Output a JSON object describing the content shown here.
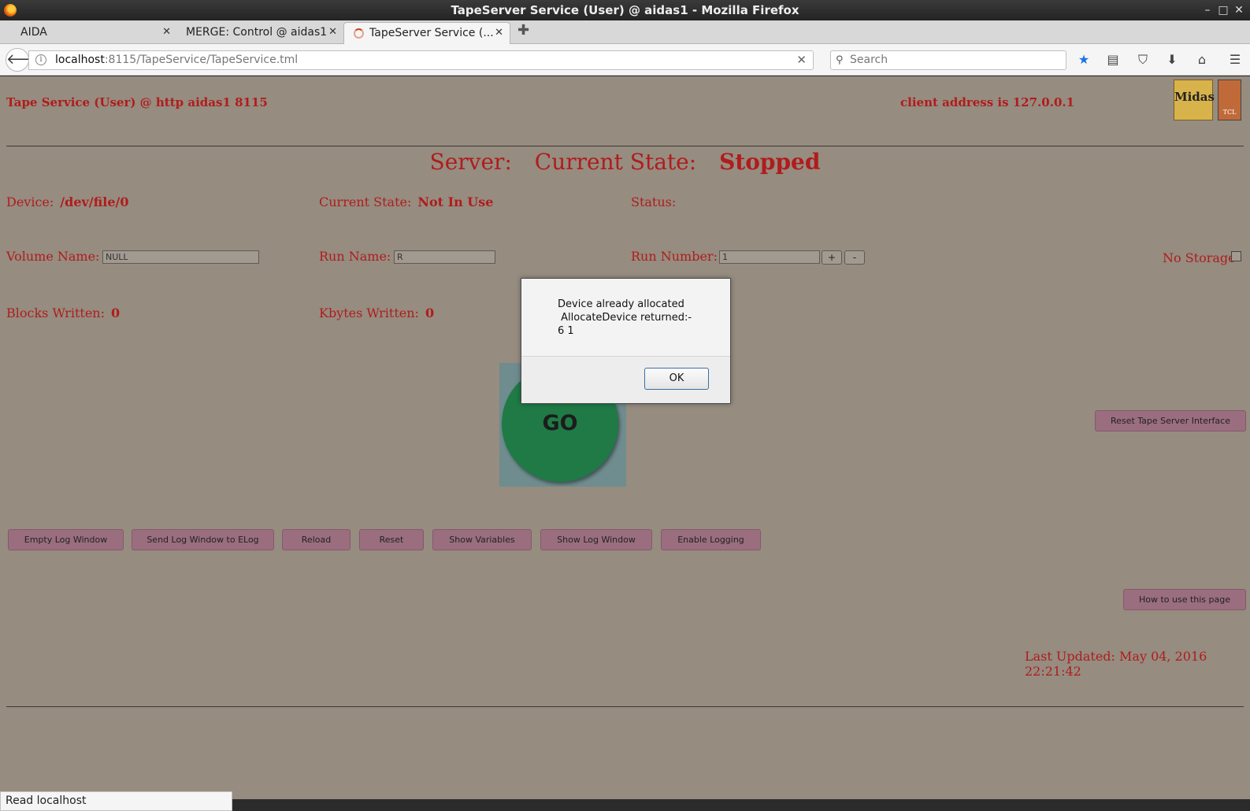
{
  "window": {
    "title": "TapeServer Service (User) @ aidas1 - Mozilla Firefox"
  },
  "tabs": [
    {
      "label": "AIDA"
    },
    {
      "label": "MERGE: Control @ aidas1"
    },
    {
      "label": "TapeServer Service (..."
    }
  ],
  "nav": {
    "url_host": "localhost",
    "url_rest": ":8115/TapeService/TapeService.tml",
    "search_placeholder": "Search"
  },
  "header": {
    "title": "Tape Service (User) @ http aidas1 8115",
    "client": "client address is 127.0.0.1",
    "logo_text": "Midas",
    "logo2_text": "TCL"
  },
  "server": {
    "label": "Server:",
    "state_label": "Current State:",
    "state": "Stopped"
  },
  "device": {
    "device_label": "Device:",
    "device_value": "/dev/file/0",
    "state_label": "Current State:",
    "state_value": "Not In Use",
    "status_label": "Status:"
  },
  "fields": {
    "volume_label": "Volume Name:",
    "volume_value": "NULL",
    "run_name_label": "Run Name:",
    "run_name_value": "R",
    "run_number_label": "Run Number:",
    "run_number_value": "1",
    "plus": "+",
    "minus": "-",
    "no_storage_label": "No Storage"
  },
  "stats": {
    "blocks_label": "Blocks Written:",
    "blocks_value": "0",
    "kbytes_label": "Kbytes Written:",
    "kbytes_value": "0"
  },
  "go_label": "GO",
  "reset_tape_button": "Reset Tape Server Interface",
  "buttons": [
    "Empty Log Window",
    "Send Log Window to ELog",
    "Reload",
    "Reset",
    "Show Variables",
    "Show Log Window",
    "Enable Logging"
  ],
  "help_button": "How to use this page",
  "last_updated": "Last Updated: May 04, 2016 22:21:42",
  "status_text": "Read localhost",
  "modal": {
    "message": "Device already allocated\n AllocateDevice returned:-\n6 1",
    "ok": "OK"
  },
  "colors": {
    "page_bg": "#968c80",
    "text_red": "#b01c1c",
    "button_bg": "#9a6e7e",
    "go_green": "#1f7a46"
  }
}
